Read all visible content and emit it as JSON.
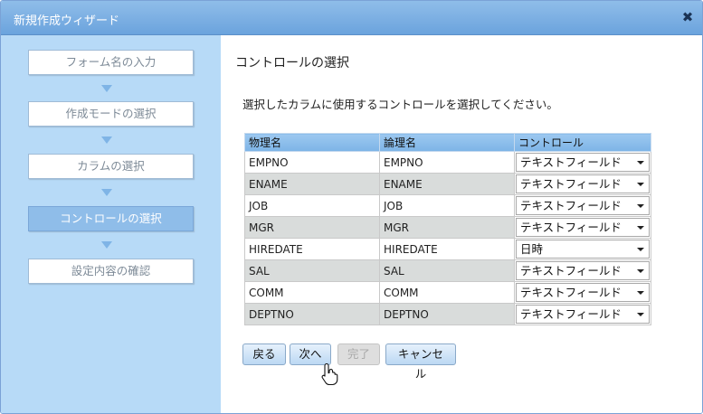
{
  "window": {
    "title": "新規作成ウィザード",
    "close_icon": "close-icon"
  },
  "sidebar": {
    "steps": [
      {
        "label": "フォーム名の入力",
        "active": false
      },
      {
        "label": "作成モードの選択",
        "active": false
      },
      {
        "label": "カラムの選択",
        "active": false
      },
      {
        "label": "コントロールの選択",
        "active": true
      },
      {
        "label": "設定内容の確認",
        "active": false
      }
    ]
  },
  "main": {
    "title": "コントロールの選択",
    "instruction": "選択したカラムに使用するコントロールを選択してください。"
  },
  "table": {
    "headers": [
      "物理名",
      "論理名",
      "コントロール"
    ],
    "rows": [
      {
        "physical": "EMPNO",
        "logical": "EMPNO",
        "control": "テキストフィールド"
      },
      {
        "physical": "ENAME",
        "logical": "ENAME",
        "control": "テキストフィールド"
      },
      {
        "physical": "JOB",
        "logical": "JOB",
        "control": "テキストフィールド"
      },
      {
        "physical": "MGR",
        "logical": "MGR",
        "control": "テキストフィールド"
      },
      {
        "physical": "HIREDATE",
        "logical": "HIREDATE",
        "control": "日時"
      },
      {
        "physical": "SAL",
        "logical": "SAL",
        "control": "テキストフィールド"
      },
      {
        "physical": "COMM",
        "logical": "COMM",
        "control": "テキストフィールド"
      },
      {
        "physical": "DEPTNO",
        "logical": "DEPTNO",
        "control": "テキストフィールド"
      }
    ]
  },
  "buttons": {
    "back": "戻る",
    "next": "次へ",
    "finish": "完了",
    "cancel": "キャンセル"
  }
}
